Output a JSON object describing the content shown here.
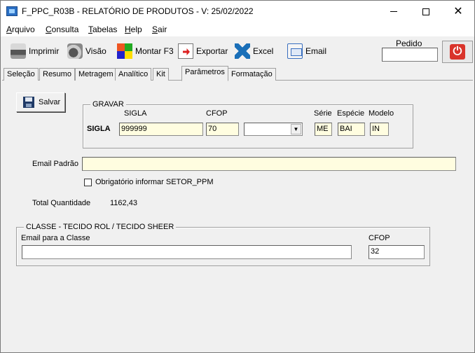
{
  "window": {
    "title": "F_PPC_R03B - RELATÓRIO DE PRODUTOS - V: 25/02/2022",
    "minimize_glyph": "",
    "close_glyph": "✕"
  },
  "menu": {
    "items": [
      {
        "underline": "A",
        "rest": "rquivo"
      },
      {
        "underline": "C",
        "rest": "onsulta"
      },
      {
        "underline": "T",
        "rest": "abelas"
      },
      {
        "underline": "H",
        "rest": "elp"
      },
      {
        "underline": "S",
        "rest": "air"
      }
    ]
  },
  "toolbar": {
    "imprimir": "Imprimir",
    "visao": "Visão",
    "montar": "Montar F3",
    "exportar": "Exportar",
    "excel": "Excel",
    "email": "Email",
    "pedido_label": "Pedido",
    "pedido_value": "",
    "power_glyph": "⏻"
  },
  "tabs": [
    "Seleção",
    "Resumo",
    "Metragem",
    "Analítico",
    "Kit",
    "Parâmetros",
    "Formatação"
  ],
  "active_tab": "Parâmetros",
  "content": {
    "salvar_label": "Salvar",
    "gravar": {
      "legend": "GRAVAR",
      "sigla_header": "SIGLA",
      "cfop_header": "CFOP",
      "serie_header": "Série",
      "especie_header": "Espécie",
      "modelo_header": "Modelo",
      "row_label": "SIGLA",
      "sigla_value": "999999",
      "cfop_value": "70",
      "combo_value": "",
      "serie_value": "ME",
      "especie_value": "BAI",
      "modelo_value": "IN"
    },
    "email_padrao_label": "Email Padrão",
    "email_padrao_value": "",
    "obrigatorio_label": "Obrigatório informar SETOR_PPM",
    "obrigatorio_checked": false,
    "total_label": "Total Quantidade",
    "total_value": "1162,43",
    "classe": {
      "legend": "CLASSE - TECIDO ROL / TECIDO SHEER",
      "email_label": "Email para a Classe",
      "email_value": "",
      "cfop_label": "CFOP",
      "cfop_value": "32"
    }
  }
}
